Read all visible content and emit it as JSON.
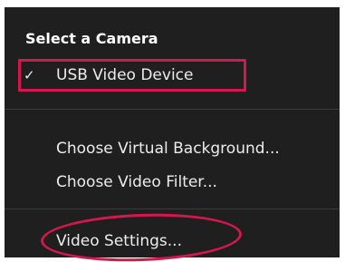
{
  "camera_menu": {
    "header": "Select a Camera",
    "items": [
      {
        "label": "USB Video Device",
        "checked": true,
        "check_glyph": "✓"
      },
      {
        "label": "Choose Virtual Background..."
      },
      {
        "label": "Choose Video Filter..."
      },
      {
        "label": "Video Settings..."
      }
    ]
  },
  "colors": {
    "menu_background": "#1f1f1f",
    "menu_text": "#ececec",
    "annotation": "#d6164f"
  },
  "icons": {
    "selected_indicator": "check-icon"
  }
}
